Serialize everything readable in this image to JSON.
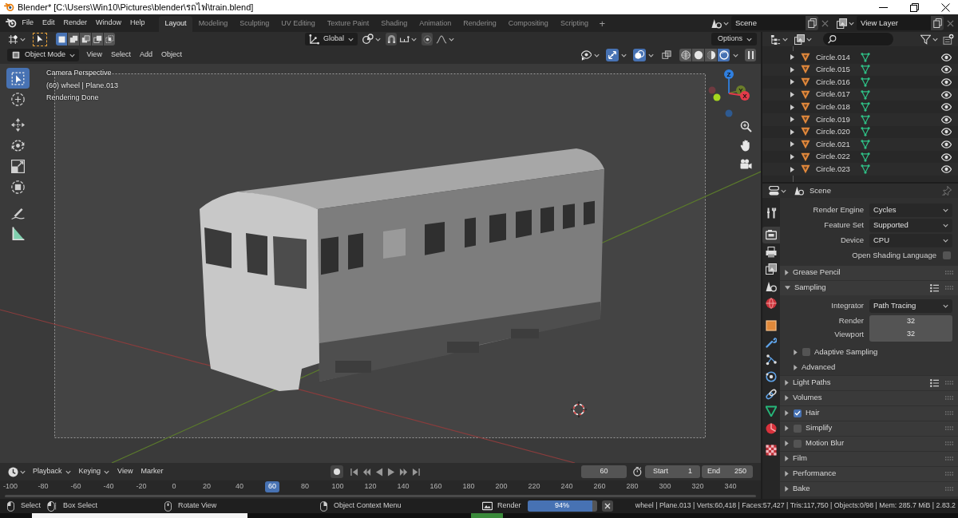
{
  "window": {
    "title": "Blender* [C:\\Users\\Win10\\Pictures\\blender\\รถไฟ\\train.blend]"
  },
  "top_bar": {
    "menus": [
      "File",
      "Edit",
      "Render",
      "Window",
      "Help"
    ],
    "workspaces": [
      {
        "label": "Layout",
        "selected": true
      },
      {
        "label": "Modeling",
        "selected": false
      },
      {
        "label": "Sculpting",
        "selected": false
      },
      {
        "label": "UV Editing",
        "selected": false
      },
      {
        "label": "Texture Paint",
        "selected": false
      },
      {
        "label": "Shading",
        "selected": false
      },
      {
        "label": "Animation",
        "selected": false
      },
      {
        "label": "Rendering",
        "selected": false
      },
      {
        "label": "Compositing",
        "selected": false
      },
      {
        "label": "Scripting",
        "selected": false
      }
    ],
    "add_workspace": "+",
    "scene": "Scene",
    "view_layer": "View Layer"
  },
  "tool_settings": {
    "select_modes": [
      {
        "kind": "set",
        "selected": true
      },
      {
        "kind": "extend",
        "selected": false
      },
      {
        "kind": "subtract",
        "selected": false
      },
      {
        "kind": "invert",
        "selected": false
      },
      {
        "kind": "intersect",
        "selected": false
      }
    ],
    "orientation": "Global",
    "options": "Options"
  },
  "viewport_header": {
    "mode": "Object Mode",
    "menus": [
      "View",
      "Select",
      "Add",
      "Object"
    ],
    "toggles": [
      {
        "kind": "gizmos",
        "on": true
      },
      {
        "kind": "overlays",
        "on": true
      },
      {
        "kind": "xray",
        "on": false
      }
    ],
    "shading": [
      {
        "kind": "wireframe",
        "selected": false
      },
      {
        "kind": "solid",
        "selected": false
      },
      {
        "kind": "material",
        "selected": false
      },
      {
        "kind": "rendered",
        "selected": true
      }
    ]
  },
  "toolbar": [
    {
      "tools": [
        {
          "kind": "select-box",
          "selected": true
        },
        {
          "kind": "cursor",
          "selected": false
        }
      ]
    },
    {
      "tools": [
        {
          "kind": "move",
          "selected": false
        },
        {
          "kind": "rotate",
          "selected": false
        },
        {
          "kind": "scale",
          "selected": false
        },
        {
          "kind": "transform",
          "selected": false
        }
      ]
    },
    {
      "tools": [
        {
          "kind": "annotate",
          "selected": false
        },
        {
          "kind": "measure",
          "selected": false
        }
      ]
    }
  ],
  "viewport": {
    "info": [
      "Camera Perspective",
      "(60) wheel | Plane.013",
      "Rendering Done"
    ],
    "gizmo_axes": [
      {
        "kind": "y",
        "label": "Y",
        "color": "#6b7d2a"
      },
      {
        "kind": "z",
        "label": "Z",
        "color": "#2f7fe0"
      },
      {
        "kind": "x",
        "label": "X",
        "color": "#e23b4a"
      }
    ]
  },
  "outliner": {
    "rows": [
      {
        "name": "Circle.014",
        "expanded": false,
        "visible": true
      },
      {
        "name": "Circle.015",
        "expanded": false,
        "visible": true
      },
      {
        "name": "Circle.016",
        "expanded": false,
        "visible": true
      },
      {
        "name": "Circle.017",
        "expanded": false,
        "visible": true
      },
      {
        "name": "Circle.018",
        "expanded": false,
        "visible": true
      },
      {
        "name": "Circle.019",
        "expanded": false,
        "visible": true
      },
      {
        "name": "Circle.020",
        "expanded": false,
        "visible": true
      },
      {
        "name": "Circle.021",
        "expanded": false,
        "visible": true
      },
      {
        "name": "Circle.022",
        "expanded": false,
        "visible": true
      },
      {
        "name": "Circle.023",
        "expanded": false,
        "visible": true
      }
    ]
  },
  "properties": {
    "context": "Scene",
    "tab_groups": [
      {
        "tabs": [
          {
            "kind": "tool",
            "selected": false
          }
        ]
      },
      {
        "tabs": [
          {
            "kind": "render",
            "selected": true
          },
          {
            "kind": "output",
            "selected": false
          },
          {
            "kind": "view-layer",
            "selected": false
          },
          {
            "kind": "scene",
            "selected": false
          },
          {
            "kind": "world",
            "selected": false
          }
        ]
      },
      {
        "tabs": [
          {
            "kind": "object",
            "selected": false
          },
          {
            "kind": "modifiers",
            "selected": false
          },
          {
            "kind": "particles",
            "selected": false
          },
          {
            "kind": "physics",
            "selected": false
          },
          {
            "kind": "constraints",
            "selected": false
          },
          {
            "kind": "data",
            "selected": false
          },
          {
            "kind": "material",
            "selected": false
          }
        ]
      },
      {
        "tabs": [
          {
            "kind": "texture",
            "selected": false
          }
        ]
      }
    ],
    "fields": [
      {
        "kind": "dropdown",
        "label": "Render Engine",
        "value": "Cycles"
      },
      {
        "kind": "dropdown",
        "label": "Feature Set",
        "value": "Supported"
      },
      {
        "kind": "dropdown",
        "label": "Device",
        "value": "CPU"
      },
      {
        "kind": "checkbox",
        "label": "Open Shading Language",
        "checked": false
      }
    ],
    "panels": [
      {
        "title": "Grease Pencil",
        "kind": "plain",
        "expanded": false,
        "presets": false
      },
      {
        "title": "Sampling",
        "kind": "plain",
        "expanded": true,
        "presets": true,
        "fields": [
          {
            "kind": "dropdown",
            "label": "Integrator",
            "value": "Path Tracing"
          },
          {
            "kind": "number",
            "label": "Render",
            "value": "32"
          },
          {
            "kind": "number",
            "label": "Viewport",
            "value": "32"
          }
        ],
        "subpanels": [
          {
            "title": "Adaptive Sampling",
            "kind": "checkbox",
            "expanded": false,
            "checked": false
          },
          {
            "title": "Advanced",
            "kind": "plain",
            "expanded": false
          }
        ]
      },
      {
        "title": "Light Paths",
        "kind": "plain",
        "expanded": false,
        "presets": true
      },
      {
        "title": "Volumes",
        "kind": "plain",
        "expanded": false,
        "presets": false
      },
      {
        "title": "Hair",
        "kind": "checkbox",
        "expanded": false,
        "presets": false,
        "checked": true
      },
      {
        "title": "Simplify",
        "kind": "checkbox",
        "expanded": false,
        "presets": false,
        "checked": false
      },
      {
        "title": "Motion Blur",
        "kind": "checkbox",
        "expanded": false,
        "presets": false,
        "checked": false
      },
      {
        "title": "Film",
        "kind": "plain",
        "expanded": false,
        "presets": false
      },
      {
        "title": "Performance",
        "kind": "plain",
        "expanded": false,
        "presets": false
      },
      {
        "title": "Bake",
        "kind": "plain",
        "expanded": false,
        "presets": false
      }
    ]
  },
  "timeline": {
    "menus": [
      {
        "label": "Playback",
        "kind": "popover"
      },
      {
        "label": "Keying",
        "kind": "popover"
      },
      {
        "label": "View",
        "kind": "menu"
      },
      {
        "label": "Marker",
        "kind": "menu"
      }
    ],
    "current_frame": "60",
    "start_label": "Start",
    "start": "1",
    "end_label": "End",
    "end": "250",
    "ruler": [
      {
        "label": "-100",
        "selected": false
      },
      {
        "label": "-80",
        "selected": false
      },
      {
        "label": "-60",
        "selected": false
      },
      {
        "label": "-40",
        "selected": false
      },
      {
        "label": "-20",
        "selected": false
      },
      {
        "label": "0",
        "selected": false
      },
      {
        "label": "20",
        "selected": false
      },
      {
        "label": "40",
        "selected": false
      },
      {
        "label": "60",
        "selected": true
      },
      {
        "label": "80",
        "selected": false
      },
      {
        "label": "100",
        "selected": false
      },
      {
        "label": "120",
        "selected": false
      },
      {
        "label": "140",
        "selected": false
      },
      {
        "label": "160",
        "selected": false
      },
      {
        "label": "180",
        "selected": false
      },
      {
        "label": "200",
        "selected": false
      },
      {
        "label": "220",
        "selected": false
      },
      {
        "label": "240",
        "selected": false
      },
      {
        "label": "260",
        "selected": false
      },
      {
        "label": "280",
        "selected": false
      },
      {
        "label": "300",
        "selected": false
      },
      {
        "label": "320",
        "selected": false
      },
      {
        "label": "340",
        "selected": false
      }
    ]
  },
  "status_bar": {
    "hints": [
      {
        "kind": "left-mouse",
        "label": "Select"
      },
      {
        "kind": "drag",
        "label": "Box Select"
      },
      {
        "kind": "middle-mouse",
        "label": "Rotate View"
      },
      {
        "kind": "right-mouse",
        "label": "Object Context Menu"
      }
    ],
    "render_label": "Render",
    "level": 0.94,
    "reading": "94%",
    "stats": "wheel | Plane.013 | Verts:60,418 | Faces:57,427 | Tris:117,750 | Objects:0/98 | Mem: 285.7 MiB | 2.83.2"
  }
}
